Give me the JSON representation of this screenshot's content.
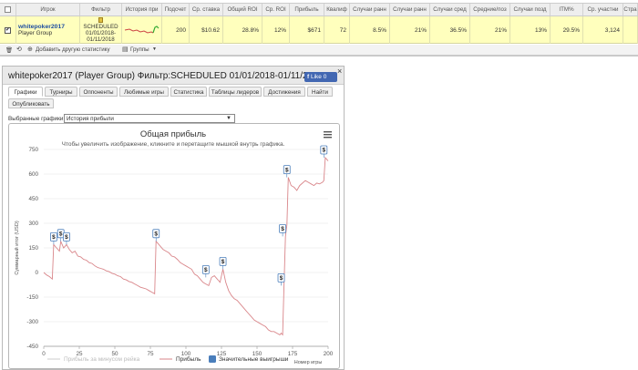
{
  "table": {
    "headers": [
      "Игрок",
      "Фильтр",
      "История при",
      "Подсчет",
      "Ср. ставка",
      "Общий ROI",
      "Ср. ROI",
      "Прибыль",
      "Квалиф",
      "Случаи ранн",
      "Случаи ранн",
      "Случаи сред",
      "Средние/поз",
      "Случаи позд",
      "ITM%",
      "Ср. участни",
      "Стра"
    ],
    "row": {
      "player": "whitepoker2017",
      "group": "Player Group",
      "filter_line1": "SCHEDULED",
      "filter_line2": "01/01/2018-",
      "filter_line3": "01/11/2018",
      "count": "200",
      "avg_stake": "$10.62",
      "total_roi": "28.8%",
      "avg_roi": "12%",
      "profit": "$671",
      "qualif": "72",
      "early1": "8.5%",
      "early2": "21%",
      "mid": "36.5%",
      "avg_pos": "21%",
      "late": "13%",
      "itm": "29.5%",
      "avg_entrants": "3,124"
    },
    "footer": {
      "add_stat": "Добавить другую статистику",
      "groups": "Группы"
    }
  },
  "panel": {
    "title": "whitepoker2017 (Player Group) Фильтр:SCHEDULED 01/01/2018-01/11/2018",
    "like": "Like 0",
    "close": "×",
    "tabs_row1": [
      "Графики",
      "Турниры",
      "Оппоненты",
      "Любимые игры",
      "Статистика",
      "Таблицы лидеров",
      "Достижения",
      "Найти"
    ],
    "tabs_row2": [
      "Опубликовать"
    ],
    "selected_label": "Выбранные графики:",
    "selected_value": "История прибыли"
  },
  "chart_data": {
    "type": "line",
    "title": "Общая прибыль",
    "subtitle": "Чтобы увеличить изображение, кликните и перетащите мышкой внутрь графика.",
    "ylabel": "Суммарный итог (USD)",
    "xlabel": "Номер игры",
    "ylim": [
      -450,
      750
    ],
    "xlim": [
      0,
      200
    ],
    "y_ticks": [
      -450,
      -300,
      -150,
      0,
      150,
      300,
      450,
      600,
      750
    ],
    "y_tick_labels": [
      "-450",
      "-300",
      "-150",
      "0",
      "150",
      "300",
      "450",
      "600",
      "750"
    ],
    "x_ticks": [
      0,
      25,
      50,
      75,
      100,
      125,
      150,
      175,
      200
    ],
    "x_tick_labels": [
      "0",
      "25",
      "50",
      "75",
      "100",
      "125",
      "150",
      "175",
      "200"
    ],
    "legend": [
      "Прибыль за минусом рейка",
      "Прибыль",
      "Значительные выигрыши"
    ],
    "legend_placement": "bottom",
    "colors": {
      "profit": "#d9868a",
      "rake": "#cccccc",
      "marker": "#4a7ebb"
    },
    "series": [
      {
        "name": "Прибыль",
        "x": [
          0,
          2,
          4,
          6,
          7,
          9,
          11,
          12,
          14,
          16,
          18,
          20,
          22,
          24,
          26,
          28,
          30,
          32,
          34,
          36,
          38,
          40,
          42,
          44,
          46,
          48,
          50,
          52,
          54,
          56,
          58,
          60,
          62,
          64,
          66,
          68,
          70,
          72,
          74,
          76,
          78,
          79,
          80,
          82,
          84,
          86,
          88,
          90,
          92,
          94,
          96,
          98,
          100,
          102,
          104,
          106,
          108,
          110,
          112,
          114,
          116,
          118,
          120,
          122,
          123,
          124,
          126,
          128,
          130,
          132,
          134,
          136,
          138,
          140,
          142,
          144,
          146,
          148,
          150,
          152,
          154,
          156,
          158,
          160,
          162,
          164,
          166,
          167,
          168,
          169,
          170,
          171,
          172,
          174,
          176,
          178,
          180,
          182,
          184,
          186,
          188,
          190,
          192,
          194,
          196,
          197,
          198,
          200
        ],
        "y": [
          0,
          -15,
          -25,
          -40,
          170,
          150,
          130,
          190,
          150,
          170,
          140,
          120,
          130,
          100,
          95,
          80,
          75,
          60,
          55,
          40,
          30,
          25,
          20,
          10,
          5,
          -5,
          -10,
          -20,
          -25,
          -40,
          -45,
          -55,
          -60,
          -70,
          -80,
          -90,
          -95,
          -100,
          -110,
          -120,
          -130,
          190,
          180,
          160,
          140,
          130,
          120,
          100,
          95,
          80,
          60,
          50,
          40,
          30,
          20,
          -10,
          -20,
          -40,
          -60,
          -70,
          -80,
          -30,
          -20,
          -40,
          -50,
          -60,
          20,
          -60,
          -110,
          -140,
          -160,
          -170,
          -190,
          -210,
          -230,
          -250,
          -270,
          -290,
          -300,
          -310,
          -320,
          -330,
          -350,
          -360,
          -360,
          -370,
          -380,
          -370,
          -380,
          -80,
          220,
          290,
          580,
          530,
          520,
          500,
          530,
          545,
          560,
          550,
          540,
          530,
          545,
          540,
          550,
          560,
          700,
          680
        ]
      }
    ],
    "markers": [
      {
        "x": 7,
        "y": 170,
        "label": "$"
      },
      {
        "x": 12,
        "y": 190,
        "label": "$"
      },
      {
        "x": 16,
        "y": 170,
        "label": "$"
      },
      {
        "x": 79,
        "y": 190,
        "label": "$"
      },
      {
        "x": 114,
        "y": -30,
        "label": "$"
      },
      {
        "x": 126,
        "y": 20,
        "label": "$"
      },
      {
        "x": 167,
        "y": -80,
        "label": "$"
      },
      {
        "x": 168,
        "y": 220,
        "label": "$"
      },
      {
        "x": 171,
        "y": 580,
        "label": "$"
      },
      {
        "x": 197,
        "y": 700,
        "label": "$"
      }
    ]
  }
}
